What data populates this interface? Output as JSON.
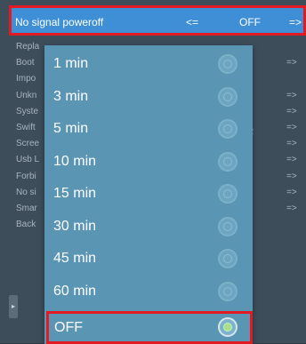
{
  "header": {
    "title": "No signal poweroff",
    "prev": "<=",
    "value": "OFF",
    "next": "=>"
  },
  "background_items": [
    "Repla",
    "Boot",
    "Impo",
    "Unkn",
    "Syste",
    "Swift",
    "Scree",
    "Usb L",
    "Forbi",
    "No si",
    "Smar",
    "Back"
  ],
  "background_arrows": [
    "",
    "=>",
    "",
    "=>",
    "=>",
    "=>",
    "=>",
    "=>",
    "=>",
    "=>",
    "=>",
    ""
  ],
  "background_extra": "R",
  "options": [
    {
      "label": "1 min",
      "selected": false
    },
    {
      "label": "3 min",
      "selected": false
    },
    {
      "label": "5 min",
      "selected": false
    },
    {
      "label": "10 min",
      "selected": false
    },
    {
      "label": "15 min",
      "selected": false
    },
    {
      "label": "30 min",
      "selected": false
    },
    {
      "label": "45 min",
      "selected": false
    },
    {
      "label": "60 min",
      "selected": false
    },
    {
      "label": "OFF",
      "selected": true
    }
  ],
  "colors": {
    "header_bg": "#3e8fd6",
    "highlight_border": "#e21b22",
    "dropdown_bg": "#5a95b3",
    "screen_bg": "#3d4d5a",
    "selected_radio": "#a6e08a"
  }
}
